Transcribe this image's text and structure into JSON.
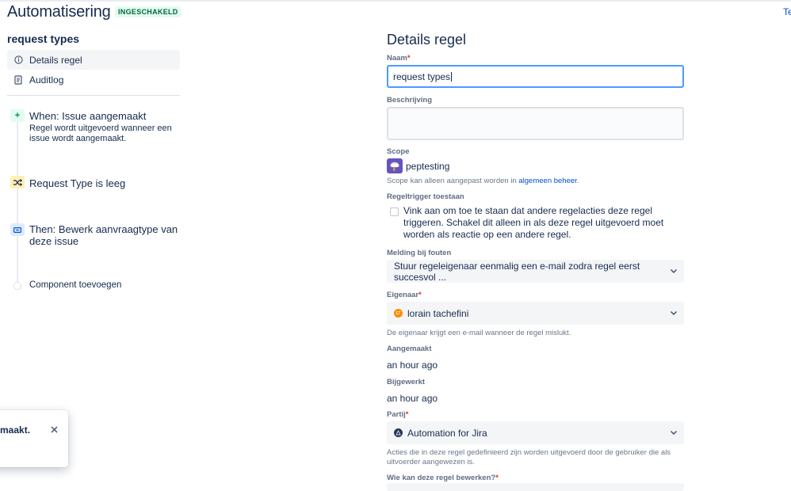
{
  "header": {
    "title": "Automatisering",
    "status_badge": "INGESCHAKELD",
    "right_link": "Te"
  },
  "sidebar": {
    "rule_name": "request types",
    "nav": [
      {
        "label": "Details regel",
        "icon": "info-icon",
        "active": true
      },
      {
        "label": "Auditlog",
        "icon": "document-icon",
        "active": false
      }
    ],
    "steps": [
      {
        "title": "When: Issue aangemaakt",
        "desc": "Regel wordt uitgevoerd wanneer een issue wordt aangemaakt.",
        "icon": "plus-icon",
        "color": "#E3FCEF"
      },
      {
        "title": "Request Type is leeg",
        "desc": "",
        "icon": "shuffle-icon",
        "color": "#FFF0B3"
      },
      {
        "title": "Then: Bewerk aanvraagtype van deze issue",
        "desc": "",
        "icon": "edit-field-icon",
        "color": "#DEEBFF"
      }
    ],
    "add_component": "Component toevoegen"
  },
  "toast": {
    "text": "maakt.",
    "close_icon": "close-icon"
  },
  "form": {
    "title": "Details regel",
    "name_label": "Naam",
    "name_value": "request types",
    "description_label": "Beschrijving",
    "description_value": "",
    "scope_label": "Scope",
    "scope_value": "peptesting",
    "scope_help_prefix": "Scope kan alleen aangepast worden in ",
    "scope_help_link": "algemeen beheer",
    "scope_help_suffix": ".",
    "trigger_label": "Regeltrigger toestaan",
    "trigger_checkbox_text": "Vink aan om toe te staan dat andere regelacties deze regel triggeren. Schakel dit alleen in als deze regel uitgevoerd moet worden als reactie op een andere regel.",
    "trigger_checked": false,
    "error_label": "Melding bij fouten",
    "error_value": "Stuur regeleigenaar eenmalig een e-mail zodra regel eerst succesvol ...",
    "owner_label": "Eigenaar",
    "owner_value": "lorain tachefini",
    "owner_initials": "LT",
    "owner_help": "De eigenaar krijgt een e-mail wanneer de regel mislukt.",
    "created_label": "Aangemaakt",
    "created_value": "an hour ago",
    "updated_label": "Bijgewerkt",
    "updated_value": "an hour ago",
    "actor_label": "Partij",
    "actor_value": "Automation for Jira",
    "actor_help": "Acties die in deze regel gedefinieerd zijn worden uitgevoerd door de gebruiker die als uitvoerder aangewezen is.",
    "editors_label": "Wie kan deze regel bewerken?",
    "required_mark": "*"
  }
}
